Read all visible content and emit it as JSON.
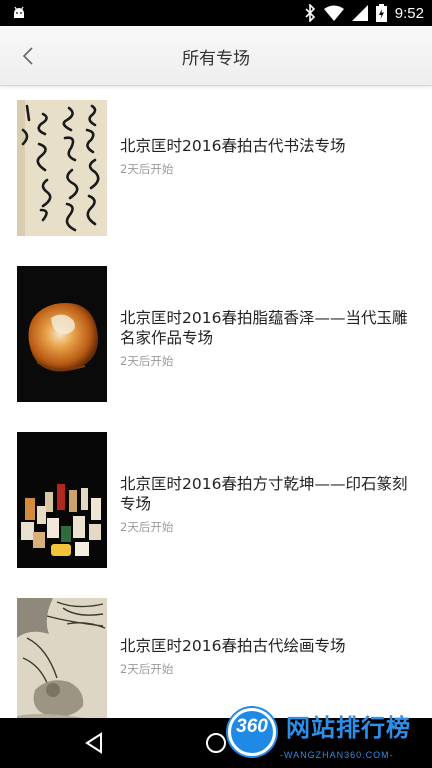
{
  "status_bar": {
    "time": "9:52"
  },
  "header": {
    "title": "所有专场"
  },
  "items": [
    {
      "title": "北京匡时2016春拍古代书法专场",
      "status": "2天后开始",
      "thumb": "calligraphy-image"
    },
    {
      "title": "北京匡时2016春拍脂蕴香泽——当代玉雕名家作品专场",
      "status": "2天后开始",
      "thumb": "jade-carving-image"
    },
    {
      "title": "北京匡时2016春拍方寸乾坤——印石篆刻专场",
      "status": "2天后开始",
      "thumb": "seal-stones-image"
    },
    {
      "title": "北京匡时2016春拍古代绘画专场",
      "status": "2天后开始",
      "thumb": "ancient-painting-image"
    }
  ],
  "watermark": {
    "logo": "360",
    "text": "网站排行榜",
    "url": "-WANGZHAN360.COM-"
  },
  "colors": {
    "accent": "#1f8ae6",
    "title": "#222222",
    "status": "#9a9a9a"
  }
}
